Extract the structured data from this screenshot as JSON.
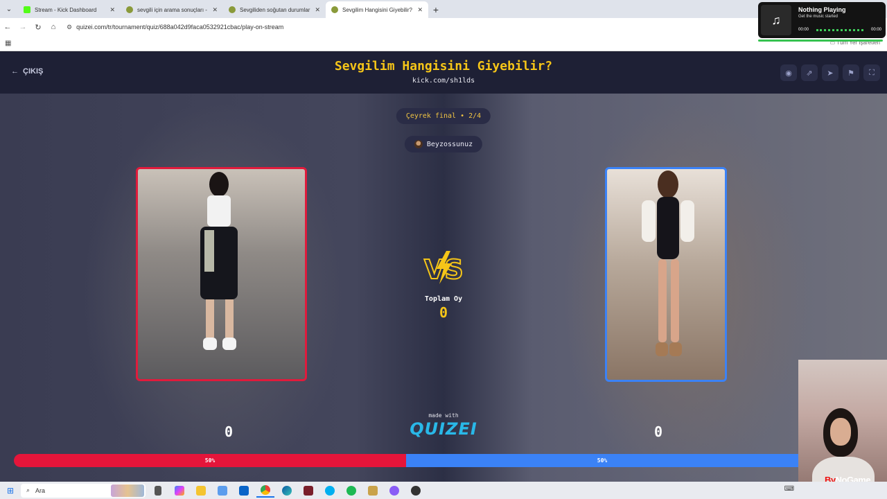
{
  "browser": {
    "tabs": [
      {
        "label": "Stream - Kick Dashboard",
        "color": "#53fc18"
      },
      {
        "label": "sevgili için arama sonuçları - Qu",
        "color": "#8a9a3a"
      },
      {
        "label": "Sevgiliden soğutan durumlar -",
        "color": "#8a9a3a"
      },
      {
        "label": "Sevgilim Hangisini Giyebilir? - Q",
        "color": "#8a9a3a"
      }
    ],
    "url": "quizei.com/tr/tournament/quiz/688a042d9faca0532921cbac/play-on-stream",
    "all_bookmarks": "Tüm Yer İşaretleri"
  },
  "quiz": {
    "exit_label": "ÇIKIŞ",
    "title": "Sevgilim Hangisini Giyebilir?",
    "channel": "kick.com/sh1lds",
    "round": "Çeyrek final • 2/4",
    "user": "Beyzossunuz",
    "total_label": "Toplam Oy",
    "total_votes": "0",
    "made_with": "made with",
    "brand": "QUIZEI",
    "left_score": "0",
    "right_score": "0",
    "left_percent": "50%",
    "right_percent": "50%",
    "left_ratio": 0.5,
    "colors": {
      "left": "#e5153a",
      "right": "#3b82f6",
      "accent": "#f5c518"
    }
  },
  "now_playing": {
    "title": "Nothing Playing",
    "subtitle": "Get the music started",
    "time_start": "00:00",
    "time_end": "00:00"
  },
  "taskbar": {
    "search_label": "Ara"
  },
  "webcam": {
    "watermark_left": "By",
    "watermark_right": "NoGame"
  }
}
